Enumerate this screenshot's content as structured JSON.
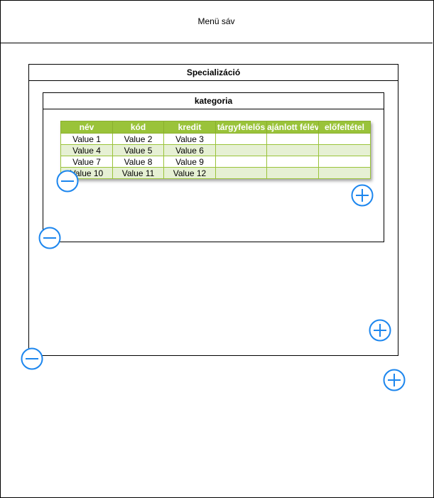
{
  "menubar": {
    "label": "Menü sáv"
  },
  "specializacio": {
    "title": "Specializáció"
  },
  "kategoria": {
    "title": "kategoria"
  },
  "table": {
    "headers": [
      "név",
      "kód",
      "kredit",
      "tárgyfelelős",
      "ajánlott félév",
      "előfeltétel"
    ],
    "rows": [
      [
        "Value 1",
        "Value 2",
        "Value 3",
        "",
        "",
        ""
      ],
      [
        "Value 4",
        "Value 5",
        "Value 6",
        "",
        "",
        ""
      ],
      [
        "Value 7",
        "Value 8",
        "Value 9",
        "",
        "",
        ""
      ],
      [
        "Value 10",
        "Value 11",
        "Value 12",
        "",
        "",
        ""
      ]
    ]
  },
  "icons": {
    "minus": "minus-circle-icon",
    "plus": "plus-circle-icon",
    "color": "#1c86ee"
  },
  "colors": {
    "header_bg": "#9ac33a",
    "row_alt_bg": "#e6f0d4"
  }
}
